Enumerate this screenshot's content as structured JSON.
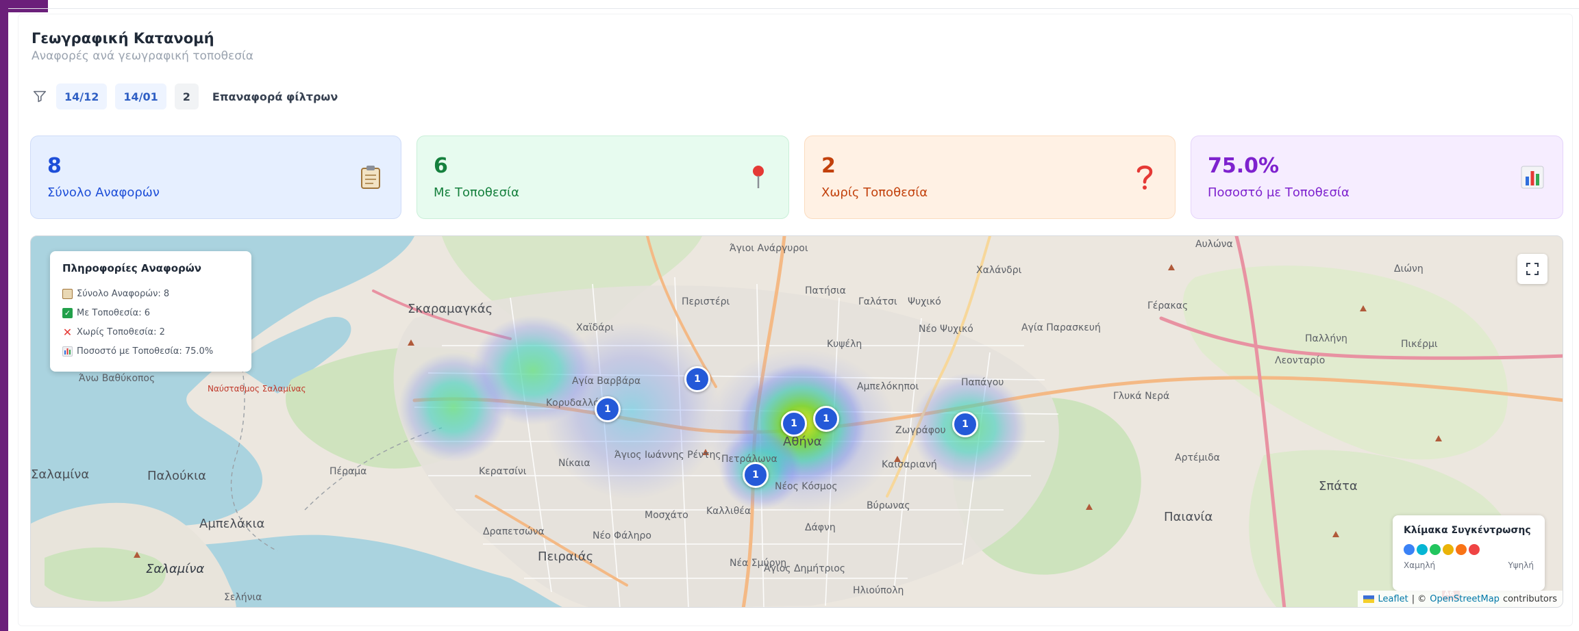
{
  "header": {
    "title": "Γεωγραφική Κατανομή",
    "subtitle": "Αναφορές ανά γεωγραφική τοποθεσία"
  },
  "filters": {
    "icon": "filter-icon",
    "date_from": "14/12",
    "date_to": "14/01",
    "count": "2",
    "reset_label": "Επαναφορά φίλτρων"
  },
  "stats": [
    {
      "value": "8",
      "label": "Σύνολο Αναφορών",
      "icon": "clipboard-icon",
      "color": "#1d4ed8"
    },
    {
      "value": "6",
      "label": "Με Τοποθεσία",
      "icon": "pin-icon",
      "color": "#15803d"
    },
    {
      "value": "2",
      "label": "Χωρίς Τοποθεσία",
      "icon": "question-icon",
      "color": "#c2410c"
    },
    {
      "value": "75.0%",
      "label": "Ποσοστό με Τοποθεσία",
      "icon": "bar-chart-icon",
      "color": "#7e22ce"
    }
  ],
  "map": {
    "info_box": {
      "title": "Πληροφορίες Αναφορών",
      "lines": [
        "Σύνολο Αναφορών: 8",
        "Με Τοποθεσία: 6",
        "Χωρίς Τοποθεσία: 2",
        "Ποσοστό με Τοποθεσία: 75.0%"
      ]
    },
    "markers": [
      {
        "label": "1",
        "place": "Κορυδαλλός"
      },
      {
        "label": "1",
        "place": "Περιστέρι"
      },
      {
        "label": "1",
        "place": "Αθήνα"
      },
      {
        "label": "1",
        "place": "Αθήνα"
      },
      {
        "label": "1",
        "place": "Ζωγράφου"
      },
      {
        "label": "1",
        "place": "Πετράλωνα"
      }
    ],
    "places": [
      "Άγιοι Ανάργυροι",
      "Αυλώνα",
      "Χαλάνδρι",
      "Διώνη",
      "Σκαραμαγκάς",
      "Περιστέρι",
      "Πατήσια",
      "Γαλάτσι",
      "Ψυχικό",
      "Γέρακας",
      "Σπάτα",
      "Χαϊδάρι",
      "Νέο Ψυχικό",
      "Αγία Παρασκευή",
      "Παλλήνη",
      "Πικέρμι",
      "Κυψέλη",
      "Λεονταρίο",
      "Άνω Βαθύκοπος",
      "Αγία Βαρβάρα",
      "Αμπελόκηποι",
      "Παπάγου",
      "Κορυδαλλός",
      "Ναύσταθμος Σαλαμίνας",
      "Γλυκά Νερά",
      "Αθήνα",
      "Ζωγράφου",
      "Άγιος Ιωάννης Ρέντης",
      "Νίκαια",
      "Πετράλωνα",
      "Αρτέμιδα",
      "Πέραμα",
      "Κερατσίνι",
      "Καισαριανή",
      "Σαλαμίνα",
      "Παλούκια",
      "Νέος Κόσμος",
      "Βύρωνας",
      "Μοσχάτο",
      "Καλλιθέα",
      "Αμπελάκια",
      "Δραπετσώνα",
      "Νέο Φάληρο",
      "Δάφνη",
      "Παιανία",
      "Πειραιάς",
      "Νέα Σμύρνη",
      "Άγιος Δημήτριος",
      "Ηλιούπολη",
      "Σελήνια",
      "Α6"
    ],
    "legend": {
      "title": "Κλίμακα Συγκέντρωσης",
      "low_label": "Χαμηλή",
      "high_label": "Υψηλή",
      "colors": [
        "#3b82f6",
        "#06b6d4",
        "#22c55e",
        "#eab308",
        "#f97316",
        "#ef4444"
      ]
    },
    "attribution": {
      "leaflet": "Leaflet",
      "separator": "| ©",
      "osm": "OpenStreetMap",
      "contributors": "contributors"
    }
  }
}
